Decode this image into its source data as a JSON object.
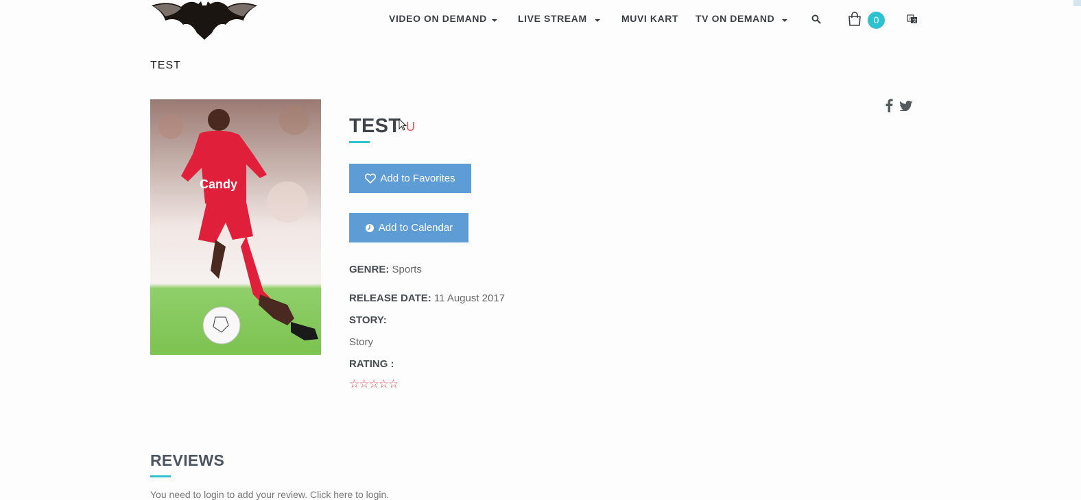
{
  "nav": {
    "items": [
      {
        "label": "VIDEO ON DEMAND",
        "has_dropdown": true
      },
      {
        "label": "LIVE STREAM",
        "has_dropdown": true
      },
      {
        "label": "MUVI KART",
        "has_dropdown": false
      },
      {
        "label": "TV ON DEMAND",
        "has_dropdown": true
      }
    ],
    "cart_count": "0",
    "icons": [
      "search-icon",
      "cart-icon",
      "language-icon"
    ]
  },
  "breadcrumb": "TEST",
  "content": {
    "title": "TEST",
    "rating_label": "U",
    "favorites_button": "Add to Favorites",
    "calendar_button": "Add to Calendar",
    "genre_label": "GENRE:",
    "genre_value": "Sports",
    "release_label": "RELEASE DATE:",
    "release_value": "11 August 2017",
    "story_label": "STORY:",
    "story_value": "Story",
    "rating_heading": "RATING :",
    "stars": "☆☆☆☆☆"
  },
  "reviews": {
    "title": "REVIEWS",
    "login_text": "You need to login to add your review.",
    "login_link": "Click here to login."
  },
  "colors": {
    "accent": "#2ec2d0",
    "button": "#5d9cd5",
    "rating": "#e8505b"
  }
}
